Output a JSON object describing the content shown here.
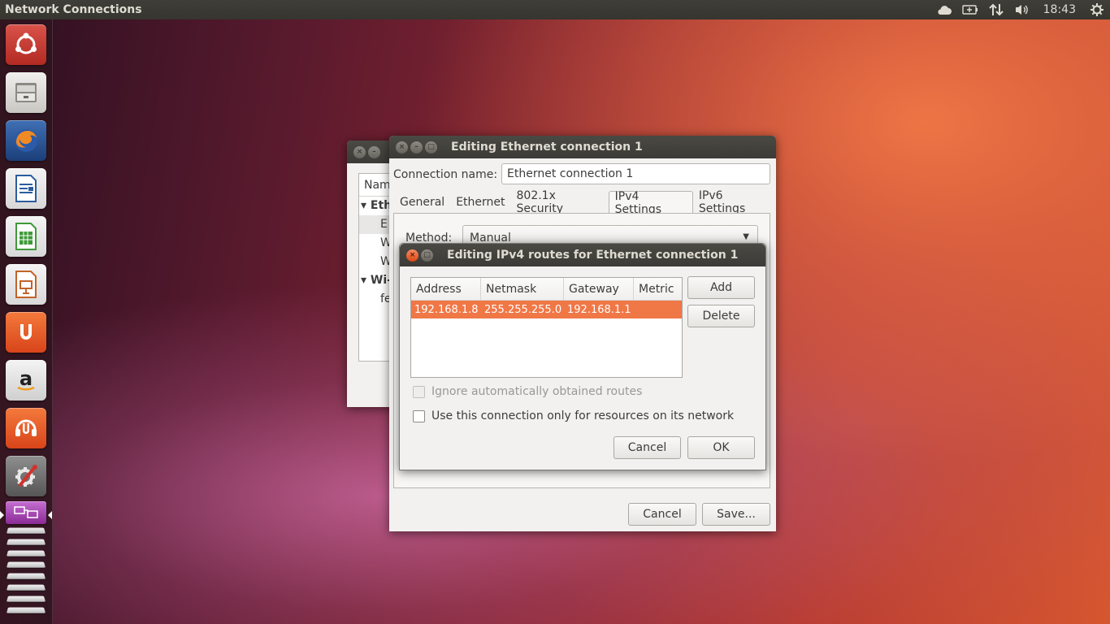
{
  "top_panel": {
    "title": "Network Connections",
    "clock": "18:43",
    "tray_icons": [
      "cloud-icon",
      "battery-icon",
      "network-updown-icon",
      "volume-icon",
      "gear-icon"
    ]
  },
  "launcher": {
    "items": [
      "ubuntu-dash",
      "files",
      "firefox",
      "libreoffice-writer",
      "libreoffice-calc",
      "libreoffice-impress",
      "ubuntu-software-center",
      "amazon",
      "ubuntu-one-music",
      "system-settings",
      "network-connections"
    ]
  },
  "back_window": {
    "list_header": "Nam",
    "group_ethernet": "Eth",
    "item_e": "E",
    "item_w1": "W",
    "item_w2": "W",
    "group_wifi": "Wi-",
    "item_fe": "fe"
  },
  "edit_window": {
    "title": "Editing Ethernet connection 1",
    "connection_name_label": "Connection name:",
    "connection_name_value": "Ethernet connection 1",
    "tabs": [
      "General",
      "Ethernet",
      "802.1x Security",
      "IPv4 Settings",
      "IPv6 Settings"
    ],
    "active_tab": "IPv4 Settings",
    "method_label": "Method:",
    "method_value": "Manual",
    "cancel_label": "Cancel",
    "save_label": "Save..."
  },
  "routes_dialog": {
    "title": "Editing IPv4 routes for Ethernet connection 1",
    "columns": [
      "Address",
      "Netmask",
      "Gateway",
      "Metric"
    ],
    "rows": [
      {
        "address": "192.168.1.8",
        "netmask": "255.255.255.0",
        "gateway": "192.168.1.1",
        "metric": ""
      }
    ],
    "add_label": "Add",
    "delete_label": "Delete",
    "ignore_label": "Ignore automatically obtained routes",
    "use_only_label": "Use this connection only for resources on its network",
    "cancel_label": "Cancel",
    "ok_label": "OK"
  },
  "colors": {
    "selection": "#f07746",
    "titlebar": "#3c3b37",
    "close_active": "#dd4814"
  }
}
